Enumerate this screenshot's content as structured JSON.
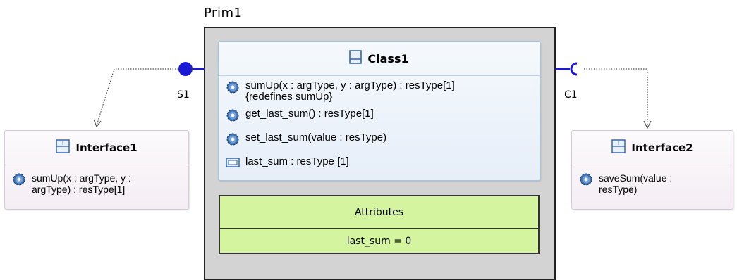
{
  "component": {
    "name": "Prim1"
  },
  "class": {
    "name": "Class1",
    "members": [
      {
        "icon": "gear-icon",
        "text": "sumUp(x : argType, y : argType) : resType[1]\n{redefines sumUp}"
      },
      {
        "icon": "gear-icon",
        "text": "get_last_sum() : resType[1]"
      },
      {
        "icon": "gear-icon",
        "text": "set_last_sum(value : resType)"
      },
      {
        "icon": "property-icon",
        "text": "last_sum : resType [1]"
      }
    ]
  },
  "attributes": {
    "title": "Attributes",
    "value": "last_sum = 0"
  },
  "ports": {
    "provided": "S1",
    "required": "C1"
  },
  "interfaces": [
    {
      "name": "Interface1",
      "operation": "sumUp(x : argType, y :\nargType) : resType[1]"
    },
    {
      "name": "Interface2",
      "operation": "saveSum(value :\nresType)"
    }
  ],
  "colors": {
    "port": "#1a1ad6",
    "attributes_fill": "#d4f4a0",
    "prim_fill": "#d3d3d3"
  }
}
